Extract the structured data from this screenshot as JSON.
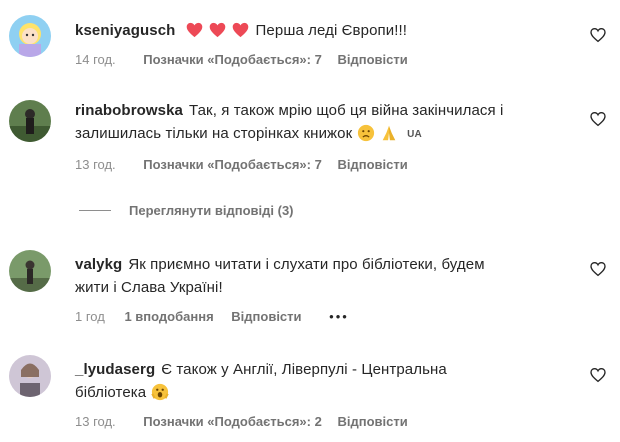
{
  "comments": [
    {
      "username": "kseniyagusch",
      "text": "Перша леді Європи!!!",
      "time": "14 год.",
      "likes": "Позначки «Подобається»: 7",
      "reply": "Відповісти"
    },
    {
      "username": "rinabobrowska",
      "text_line1": "Так, я також мрію щоб ця війна закінчилася і",
      "text_line2": "залишилась тільки на сторінках книжок",
      "flag": "UA",
      "time": "13 год.",
      "likes": "Позначки «Подобається»: 7",
      "reply": "Відповісти"
    },
    {
      "username": "valykg",
      "text_line1": "Як приємно читати і слухати про бібліотеки, будем",
      "text_line2": "жити і Слава Україні!",
      "time": "1 год",
      "likes": "1 вподобання",
      "reply": "Відповісти",
      "more": "•••"
    },
    {
      "username": "_lyudaserg",
      "text_line1": "Є також у Англії, Ліверпулі - Центральна",
      "text_line2": "бібліотека",
      "time": "13 год.",
      "likes": "Позначки «Подобається»: 2",
      "reply": "Відповісти"
    }
  ],
  "view_replies": "Переглянути відповіді (3)",
  "icons": {
    "like": "heart-outline-icon",
    "emoji_hearts": "red-heart-icon",
    "emoji_sad": "sad-face-icon",
    "emoji_pray": "folded-hands-icon",
    "emoji_scream": "screaming-face-icon"
  },
  "colors": {
    "text": "#262626",
    "meta": "#8e8e8e",
    "heart_red": "#ed4956"
  }
}
